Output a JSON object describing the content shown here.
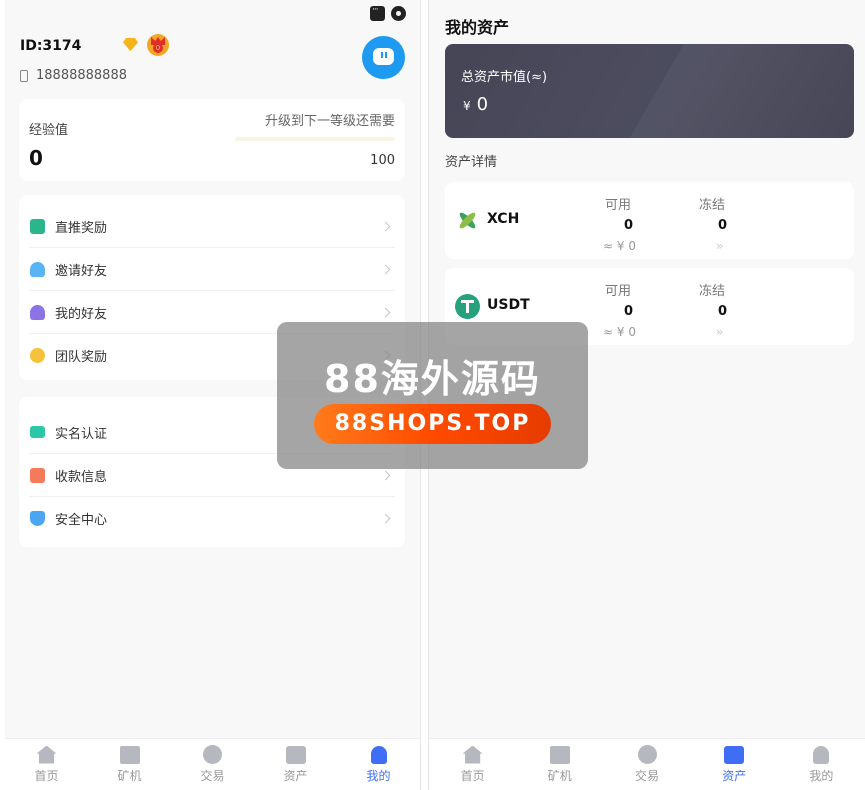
{
  "profile": {
    "id_label": "ID:3174",
    "crown_level": "0",
    "phone": "18888888888"
  },
  "experience": {
    "label": "经验值",
    "value": "0",
    "upgrade_text": "升级到下一等级还需要",
    "progress_fraction": 0,
    "next_level_value": "100"
  },
  "menu_group1": [
    {
      "label": "直推奖励",
      "icon": "thumb-up-icon",
      "color": "#2bb58c"
    },
    {
      "label": "邀请好友",
      "icon": "invite-user-icon",
      "color": "#58b4f5"
    },
    {
      "label": "我的好友",
      "icon": "friends-icon",
      "color": "#8c73e6"
    },
    {
      "label": "团队奖励",
      "icon": "pie-chart-icon",
      "color": "#f5c23c"
    }
  ],
  "menu_group2": [
    {
      "label": "实名认证",
      "icon": "id-card-icon",
      "color": "#2bc8a8"
    },
    {
      "label": "收款信息",
      "icon": "wallet-icon",
      "color": "#f47a5c"
    },
    {
      "label": "安全中心",
      "icon": "shield-icon",
      "color": "#4aa6f2"
    }
  ],
  "nav": {
    "home": "首页",
    "miner": "矿机",
    "trade": "交易",
    "assets": "资产",
    "me": "我的"
  },
  "assets_page": {
    "title": "我的资产",
    "total_label": "总资产市值(≈)",
    "currency_symbol": "¥",
    "total_value": "0",
    "detail_title": "资产详情",
    "available_label": "可用",
    "frozen_label": "冻结",
    "coins": [
      {
        "name": "XCH",
        "available": "0",
        "frozen": "0",
        "cny": "≈ ¥ 0",
        "more": "»"
      },
      {
        "name": "USDT",
        "available": "0",
        "frozen": "0",
        "cny": "≈ ¥ 0",
        "more": "»"
      }
    ]
  },
  "watermark": {
    "title": "88海外源码",
    "url": "88SHOPS.TOP"
  },
  "colors": {
    "accent": "#3f6ef5",
    "avatar": "#1e9bf0",
    "total_card": "#464657"
  }
}
